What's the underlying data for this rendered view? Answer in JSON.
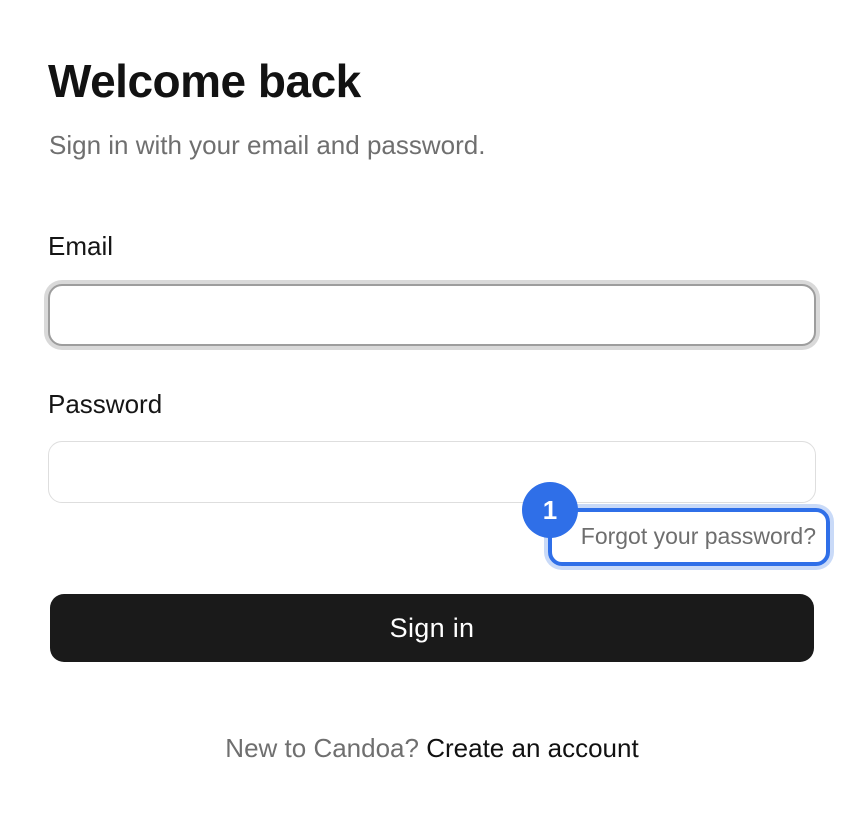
{
  "header": {
    "title": "Welcome back",
    "subtitle": "Sign in with your email and password."
  },
  "form": {
    "email_label": "Email",
    "email_value": "",
    "email_placeholder": "",
    "password_label": "Password",
    "password_value": "",
    "password_placeholder": "",
    "forgot_link": "Forgot your password?",
    "submit_label": "Sign in"
  },
  "annotation": {
    "marker_label": "1"
  },
  "footer": {
    "prompt": "New to Candoa?",
    "create_link": "Create an account"
  },
  "colors": {
    "accent": "#2f6fe8",
    "button_bg": "#1a1a1a",
    "muted_text": "#6f6f6f"
  }
}
